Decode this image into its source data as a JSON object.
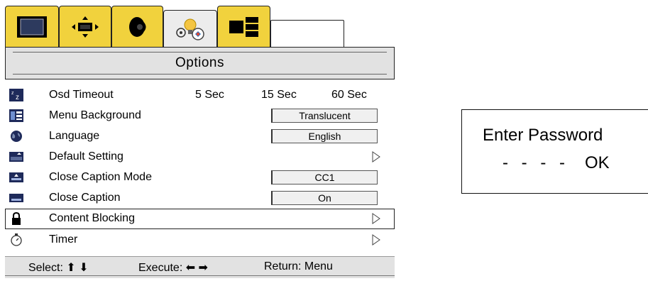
{
  "tabs": [
    {
      "icon": "picture-icon",
      "color": "#f1d23d"
    },
    {
      "icon": "position-icon",
      "color": "#f1d23d"
    },
    {
      "icon": "audio-icon",
      "color": "#f1d23d"
    },
    {
      "icon": "options-icon",
      "color": "#ececec",
      "active": true
    },
    {
      "icon": "pip-icon",
      "color": "#f1d23d"
    }
  ],
  "title": "Options",
  "menu": {
    "osd_timeout": {
      "label": "Osd Timeout",
      "options": [
        "5 Sec",
        "15 Sec",
        "60 Sec"
      ]
    },
    "menu_background": {
      "label": "Menu Background",
      "value": "Translucent"
    },
    "language": {
      "label": "Language",
      "value": "English"
    },
    "default_setting": {
      "label": "Default Setting"
    },
    "close_caption_mode": {
      "label": "Close Caption Mode",
      "value": "CC1"
    },
    "close_caption": {
      "label": "Close Caption",
      "value": "On"
    },
    "content_blocking": {
      "label": "Content Blocking",
      "selected": true
    },
    "timer": {
      "label": "Timer"
    }
  },
  "footer": {
    "select": "Select: ⬆ ⬇",
    "execute": "Execute: ⬅ ➡",
    "return": "Return:  Menu"
  },
  "password_dialog": {
    "title": "Enter Password",
    "digits": "- - - -",
    "ok": "OK"
  }
}
